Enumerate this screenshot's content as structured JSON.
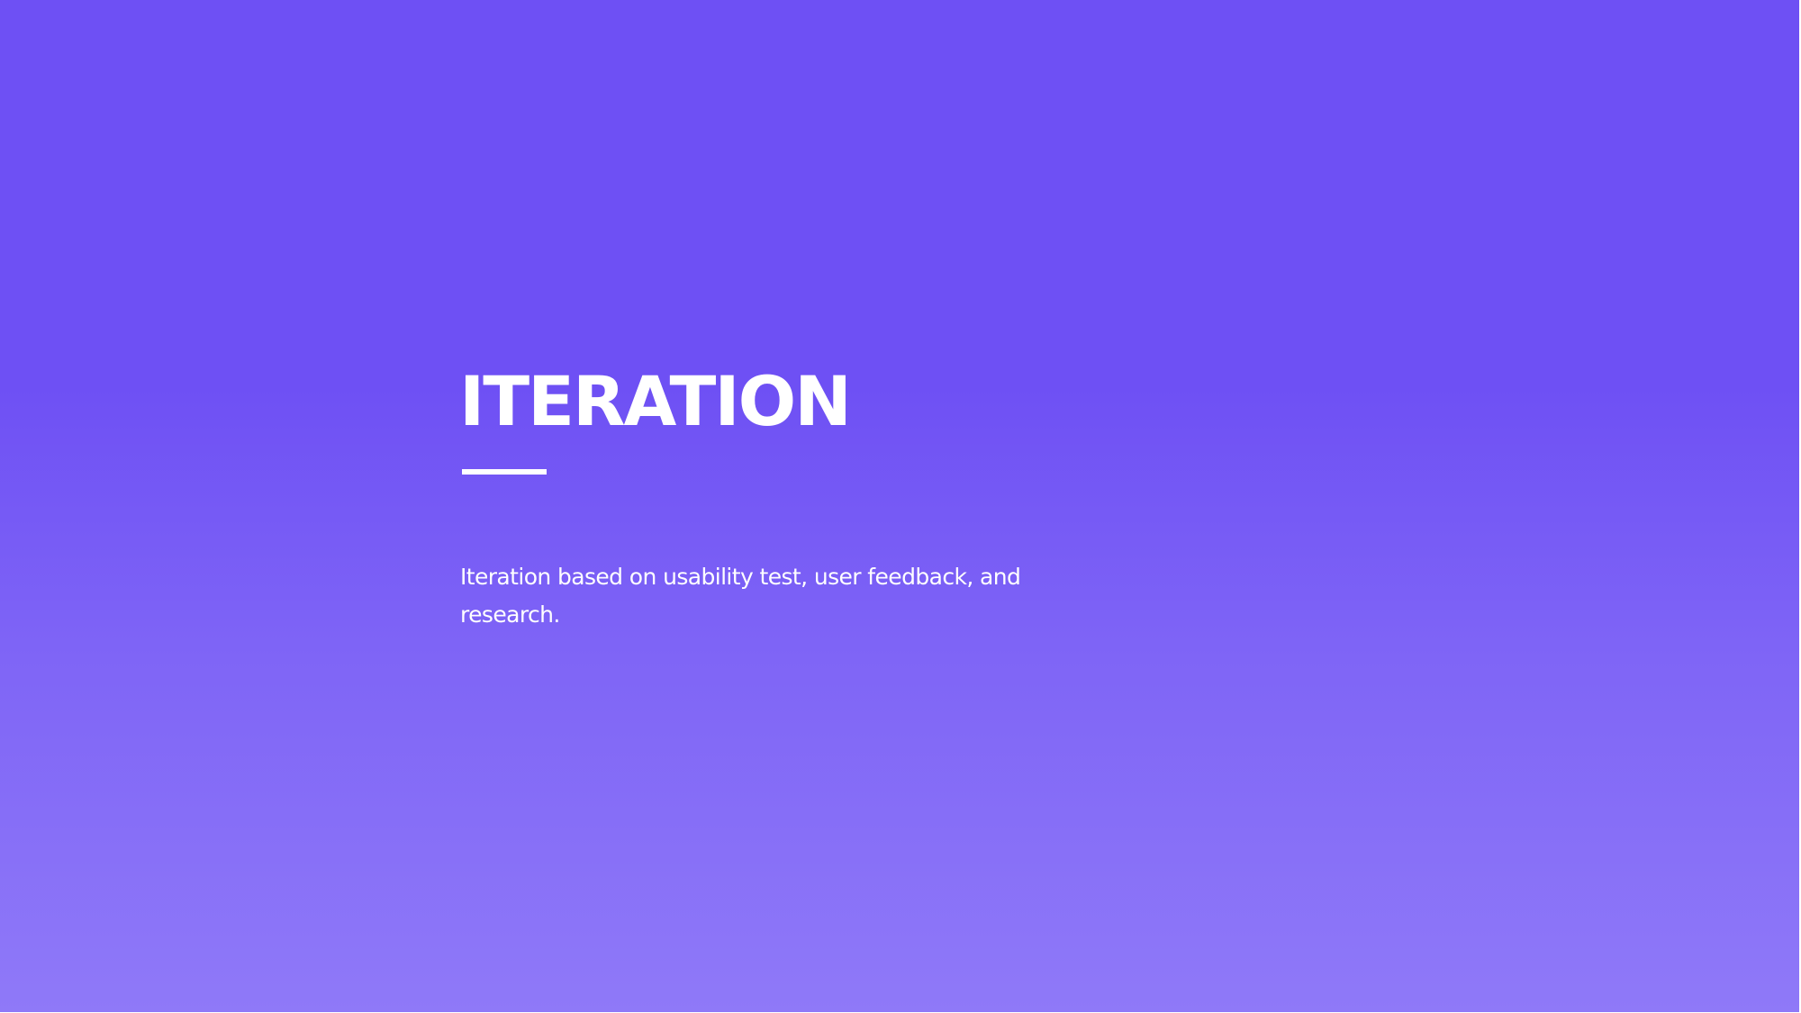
{
  "slide": {
    "title": "ITERATION",
    "subtitle": "Iteration based on usability test, user feedback, and research."
  },
  "colors": {
    "gradient_top": "#6e50f4",
    "gradient_bottom": "#8f79f8",
    "text": "#ffffff"
  }
}
